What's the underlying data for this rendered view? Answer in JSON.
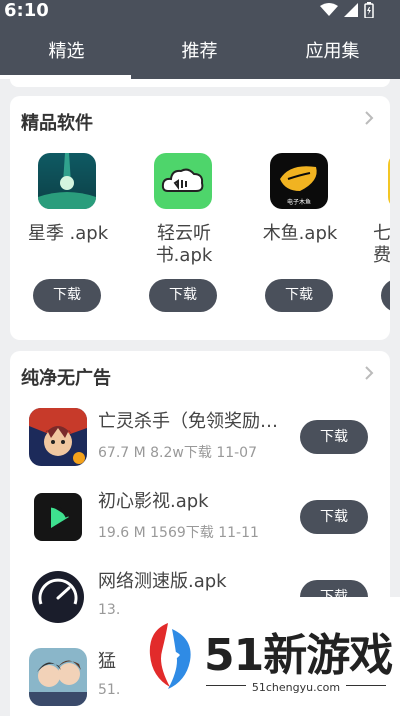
{
  "status": {
    "time": "6:10"
  },
  "tabs": [
    "精选",
    "推荐",
    "应用集"
  ],
  "section1": {
    "title": "精品软件",
    "apps": [
      {
        "name": "星季 .apk",
        "button": "下载"
      },
      {
        "name": "轻云听书.apk",
        "button": "下载"
      },
      {
        "name": "木鱼.apk",
        "button": "下载",
        "icon_caption": "电子木鱼"
      },
      {
        "name": "七 费",
        "button": ""
      }
    ]
  },
  "section2": {
    "title": "纯净无广告",
    "apps": [
      {
        "name": "亡灵杀手（免领奖励…",
        "meta": "67.7 M  8.2w下载  11-07",
        "button": "下载"
      },
      {
        "name": "初心影视.apk",
        "meta": "19.6 M  1569下载  11-11",
        "button": "下载"
      },
      {
        "name": "网络测速版.apk",
        "meta": "13.",
        "button": "下载"
      },
      {
        "name": "猛",
        "meta": "51.",
        "button": ""
      }
    ]
  },
  "watermark": {
    "text": "51新游戏",
    "url": "51chengyu.com"
  },
  "colors": {
    "header": "#4a505b",
    "background": "#eeeff1",
    "button": "#4a505b"
  }
}
